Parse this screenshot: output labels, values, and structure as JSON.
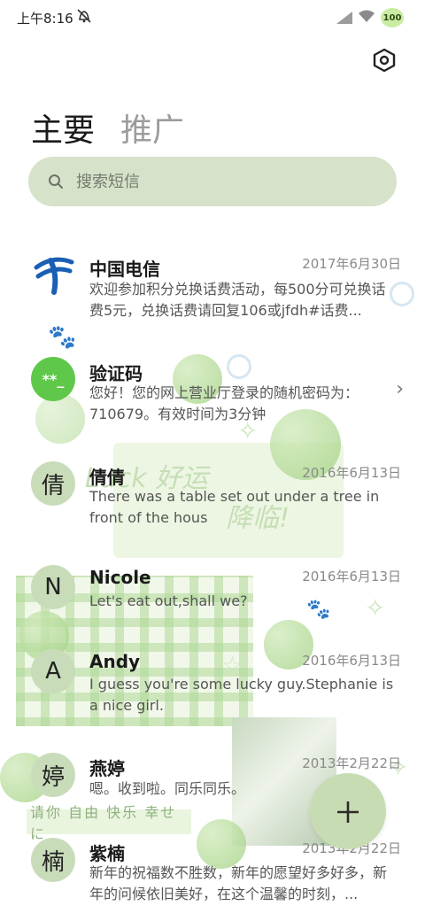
{
  "status_bar": {
    "time": "上午8:16",
    "battery": "100"
  },
  "header": {
    "tabs": [
      {
        "label": "主要",
        "active": true
      },
      {
        "label": "推广",
        "active": false
      }
    ]
  },
  "search": {
    "placeholder": "搜索短信"
  },
  "background": {
    "decor_text_1": "Luck 好运",
    "decor_text_2": "降临!",
    "banner": "请你 自由 快乐 幸せに"
  },
  "conversations": [
    {
      "avatar": "china-telecom-logo",
      "name": "中国电信",
      "date": "2017年6月30日",
      "preview": "欢迎参加积分兑换话费活动，每500分可兑换话费5元，兑换话费请回复106或jfdh#话费..."
    },
    {
      "avatar": "**_",
      "name": "验证码",
      "date": "",
      "preview": "您好！您的网上营业厅登录的随机密码为：710679。有效时间为3分钟"
    },
    {
      "avatar": "倩",
      "name": "倩倩",
      "date": "2016年6月13日",
      "preview": "There was a table set out under a tree in front of the hous"
    },
    {
      "avatar": "N",
      "name": "Nicole",
      "date": "2016年6月13日",
      "preview": "Let's eat out,shall we?"
    },
    {
      "avatar": "A",
      "name": "Andy",
      "date": "2016年6月13日",
      "preview": "I guess you're some lucky guy.Stephanie is a nice girl."
    },
    {
      "avatar": "婷",
      "name": "燕婷",
      "date": "2013年2月22日",
      "preview": "嗯。收到啦。同乐同乐。"
    },
    {
      "avatar": "楠",
      "name": "紫楠",
      "date": "2013年2月22日",
      "preview": "新年的祝福数不胜数，新年的愿望好多好多，新年的问候依旧美好，在这个温馨的时刻，..."
    }
  ],
  "colors": {
    "accent": "#c8dcb3",
    "search_bg": "#d6e2c9",
    "avatar_bg": "#c8dcb9",
    "code_avatar": "#5fc84a"
  }
}
